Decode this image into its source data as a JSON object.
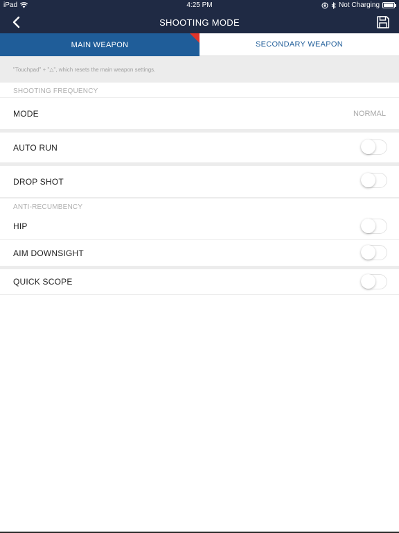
{
  "status_bar": {
    "device": "iPad",
    "time": "4:25 PM",
    "battery_text": "Not Charging"
  },
  "nav": {
    "title": "SHOOTING MODE",
    "back_icon": "chevron-left-icon",
    "save_icon": "floppy-disk-icon"
  },
  "tabs": {
    "main": "MAIN WEAPON",
    "secondary": "SECONDARY WEAPON"
  },
  "hint": "\"Touchpad\" + \"△\", which resets the main weapon settings.",
  "sections": {
    "shooting_frequency": "SHOOTING FREQUENCY",
    "anti_recumbency": "ANTI-RECUMBENCY"
  },
  "rows": {
    "mode": {
      "label": "MODE",
      "value": "NORMAL"
    },
    "auto_run": {
      "label": "AUTO RUN",
      "on": false
    },
    "drop_shot": {
      "label": "DROP SHOT",
      "on": false
    },
    "hip": {
      "label": "HIP",
      "on": false
    },
    "aim_downsight": {
      "label": "AIM DOWNSIGHT",
      "on": false
    },
    "quick_scope": {
      "label": "QUICK SCOPE",
      "on": false
    }
  },
  "colors": {
    "nav_bg": "#1f2a44",
    "tab_active": "#1f5d99",
    "accent_red": "#e0342a"
  }
}
